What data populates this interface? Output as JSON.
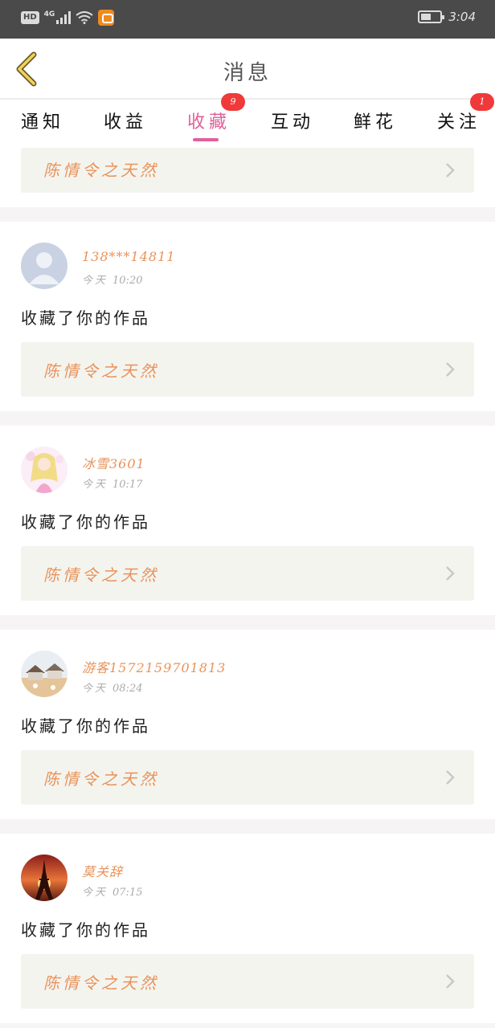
{
  "status_bar": {
    "hd": "HD",
    "network": "4G",
    "time": "3:04"
  },
  "header": {
    "title": "消息"
  },
  "tabs": [
    {
      "label": "通知"
    },
    {
      "label": "收益"
    },
    {
      "label": "收藏",
      "badge": "9",
      "active": true
    },
    {
      "label": "互动"
    },
    {
      "label": "鲜花"
    },
    {
      "label": "关注",
      "badge": "1"
    }
  ],
  "top_partial": {
    "work_title": "陈情令之天然"
  },
  "messages": [
    {
      "user": "138***14811",
      "day": "今天",
      "time": "10:20",
      "action": "收藏了你的作品",
      "work_title": "陈情令之天然",
      "avatar": "default-avatar"
    },
    {
      "user": "冰雪3601",
      "day": "今天",
      "time": "10:17",
      "action": "收藏了你的作品",
      "work_title": "陈情令之天然",
      "avatar": "anime-girl-avatar"
    },
    {
      "user": "游客1572159701813",
      "day": "今天",
      "time": "08:24",
      "action": "收藏了你的作品",
      "work_title": "陈情令之天然",
      "avatar": "cartoon-scene-avatar"
    },
    {
      "user": "莫关辞",
      "day": "今天",
      "time": "07:15",
      "action": "收藏了你的作品",
      "work_title": "陈情令之天然",
      "avatar": "eiffel-tower-avatar"
    }
  ],
  "colors": {
    "accent": "#e0609a",
    "badge": "#f03a3a",
    "orange_text": "#e8935a",
    "link_bg": "#f4f4ef",
    "status_bar": "#4a4a4a"
  }
}
